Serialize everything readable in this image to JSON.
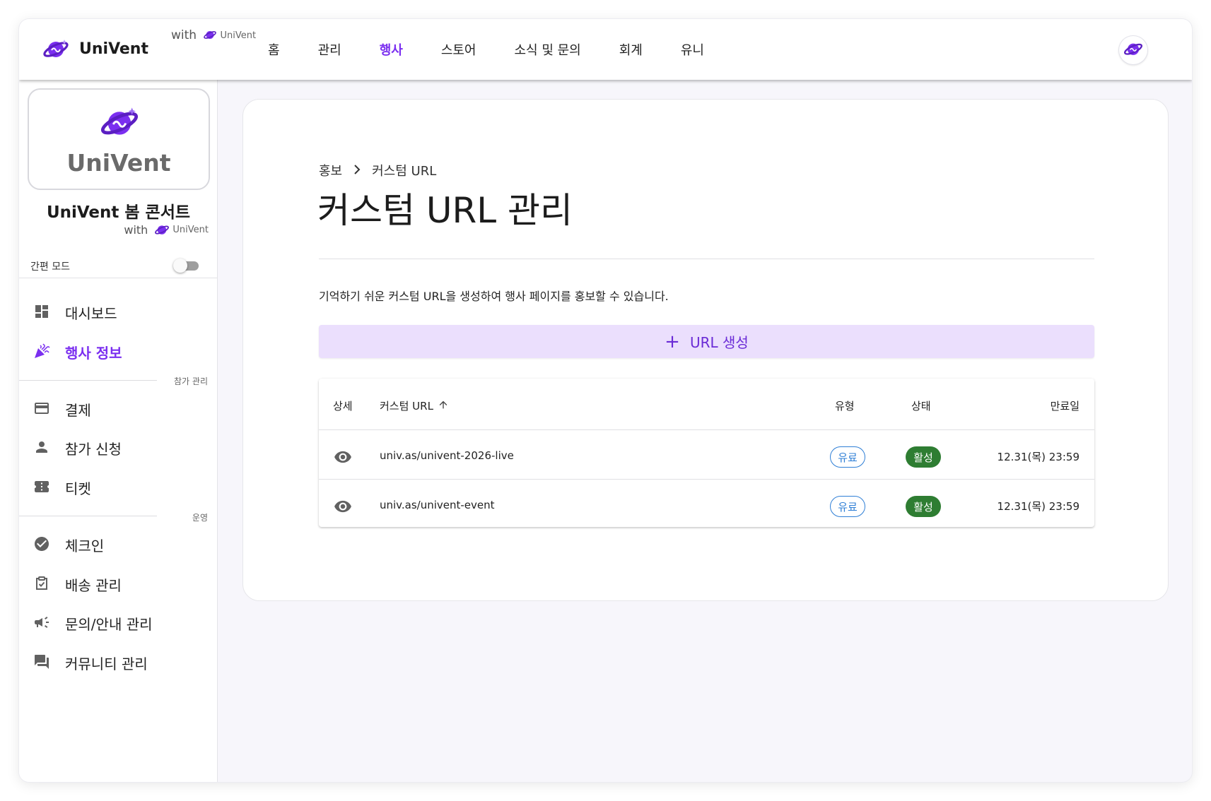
{
  "colors": {
    "accent": "#7b2ff0",
    "button_bg": "#ebdffd",
    "active_chip": "#2e7d32",
    "type_chip": "#2f7fd6"
  },
  "topbar": {
    "brand_name": "UniVent",
    "with_label": "with",
    "with_brand": "UniVent",
    "nav": [
      "홈",
      "관리",
      "행사",
      "스토어",
      "소식 및 문의",
      "회계",
      "유니"
    ],
    "active_nav": "행사",
    "profile_icon": "planet-logo-icon"
  },
  "sidebar": {
    "card_logo_text": "UniVent",
    "event_title": "UniVent 봄 콘서트",
    "with_label": "with",
    "with_brand": "UniVent",
    "simple_mode_label": "간편 모드",
    "simple_mode_on": false,
    "menu_top": [
      {
        "label": "대시보드",
        "icon": "dashboard-icon"
      },
      {
        "label": "행사 정보",
        "icon": "party-popper-icon",
        "active": true
      }
    ],
    "section_participation": "참가 관리",
    "menu_participation": [
      {
        "label": "결제",
        "icon": "credit-card-icon"
      },
      {
        "label": "참가 신청",
        "icon": "person-icon"
      },
      {
        "label": "티켓",
        "icon": "ticket-icon"
      }
    ],
    "section_operation": "운영",
    "menu_operation": [
      {
        "label": "체크인",
        "icon": "check-circle-icon"
      },
      {
        "label": "배송 관리",
        "icon": "clipboard-check-icon"
      },
      {
        "label": "문의/안내 관리",
        "icon": "campaign-icon"
      },
      {
        "label": "커뮤니티 관리",
        "icon": "forum-icon"
      }
    ]
  },
  "main": {
    "breadcrumb": [
      "홍보",
      "커스텀 URL"
    ],
    "title": "커스텀 URL 관리",
    "description": "기억하기 쉬운 커스텀 URL을 생성하여 행사 페이지를 홍보할 수 있습니다.",
    "create_button": "URL 생성",
    "table": {
      "headers": {
        "detail": "상세",
        "url": "커스텀 URL",
        "type": "유형",
        "status": "상태",
        "expiry": "만료일"
      },
      "sort_direction": "ascending",
      "rows": [
        {
          "url": "univ.as/univent-2026-live",
          "type": "유료",
          "status": "활성",
          "expiry": "12.31(목) 23:59"
        },
        {
          "url": "univ.as/univent-event",
          "type": "유료",
          "status": "활성",
          "expiry": "12.31(목) 23:59"
        }
      ]
    }
  }
}
